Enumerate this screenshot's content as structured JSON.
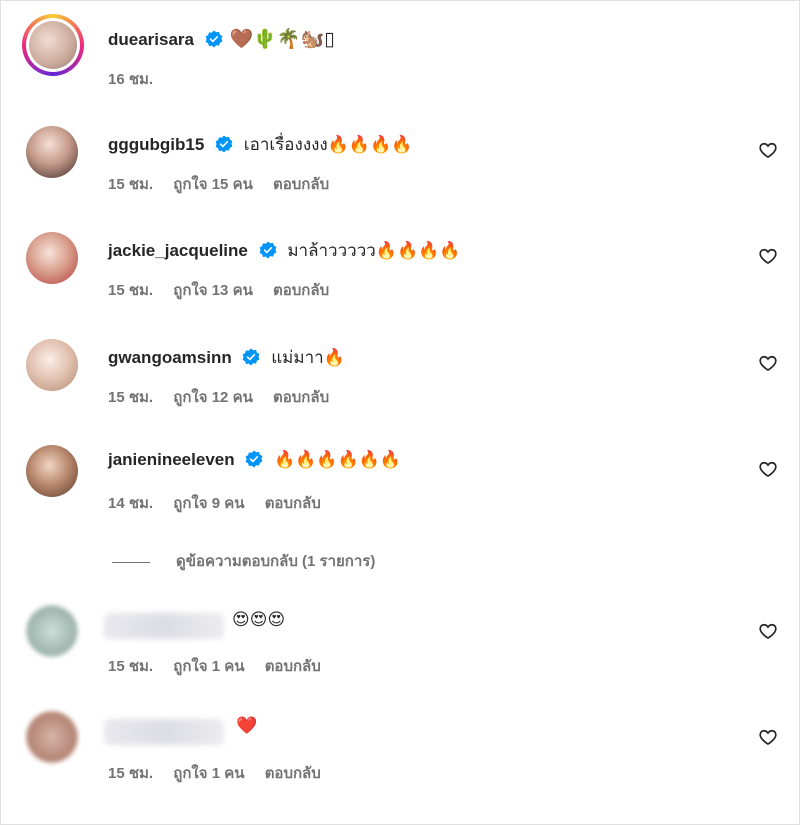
{
  "post_caption": {
    "username": "duearisara",
    "text": "🤎🌵🌴🐿️▯",
    "time": "16 ชม."
  },
  "comments": [
    {
      "username": "gggubgib15",
      "text": "เอาเรื่องงงง🔥🔥🔥🔥",
      "time": "15 ชม.",
      "likes": "ถูกใจ 15 คน",
      "reply": "ตอบกลับ"
    },
    {
      "username": "jackie_jacqueline",
      "text": "มาล้าววววว🔥🔥🔥🔥",
      "time": "15 ชม.",
      "likes": "ถูกใจ 13 คน",
      "reply": "ตอบกลับ"
    },
    {
      "username": "gwangoamsinn",
      "text": "แม่มาา🔥",
      "time": "15 ชม.",
      "likes": "ถูกใจ 12 คน",
      "reply": "ตอบกลับ"
    },
    {
      "username": "janienineeleven",
      "text": "🔥🔥🔥🔥🔥🔥",
      "time": "14 ชม.",
      "likes": "ถูกใจ 9 คน",
      "reply": "ตอบกลับ"
    },
    {
      "username": "",
      "text": "😍😍😍",
      "time": "15 ชม.",
      "likes": "ถูกใจ 1 คน",
      "reply": "ตอบกลับ"
    },
    {
      "username": "",
      "text": "❤️",
      "time": "15 ชม.",
      "likes": "ถูกใจ 1 คน",
      "reply": "ตอบกลับ"
    }
  ],
  "view_replies": "ดูข้อความตอบกลับ (1 รายการ)",
  "colors": {
    "verified": "#0095f6",
    "meta_text": "#737373",
    "primary_text": "#262626"
  },
  "icons": {
    "verified": "verified-badge-icon",
    "like": "heart-outline-icon"
  }
}
